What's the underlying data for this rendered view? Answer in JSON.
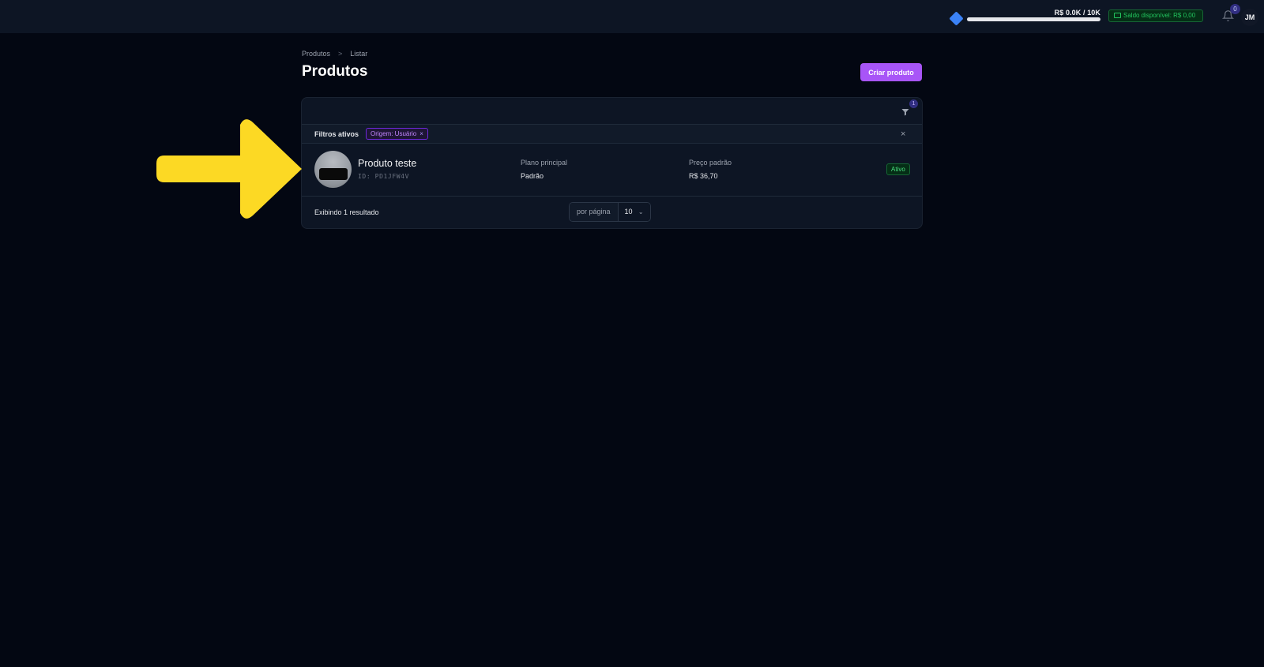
{
  "topbar": {
    "goal_text": "R$ 0.0K / 10K",
    "goal_progress": 0.0,
    "balance_text": "Saldo disponível: R$ 0,00",
    "notifications_count": "0",
    "avatar_initials": "JM"
  },
  "breadcrumb": {
    "items": [
      "Produtos",
      "Listar"
    ],
    "separator": ">"
  },
  "page": {
    "title": "Produtos",
    "create_button_label": "Criar produto"
  },
  "toolbar": {
    "filter_count": "1"
  },
  "filters": {
    "label": "Filtros ativos",
    "chip_label": "Origem: Usuário",
    "chip_remove": "×",
    "clear_all": "×"
  },
  "products": [
    {
      "name": "Produto teste",
      "id": "ID: PD1JFW4V",
      "plan_label": "Plano principal",
      "plan_value": "Padrão",
      "price_label": "Preço padrão",
      "price_value": "R$ 36,70",
      "status": "Ativo"
    }
  ],
  "footer": {
    "results_text": "Exibindo 1 resultado",
    "per_page_label": "por página",
    "per_page_value": "10"
  },
  "colors": {
    "background": "#030712",
    "accent": "#a855f7",
    "success": "#22c55e",
    "annotation_arrow": "#fcd924"
  }
}
